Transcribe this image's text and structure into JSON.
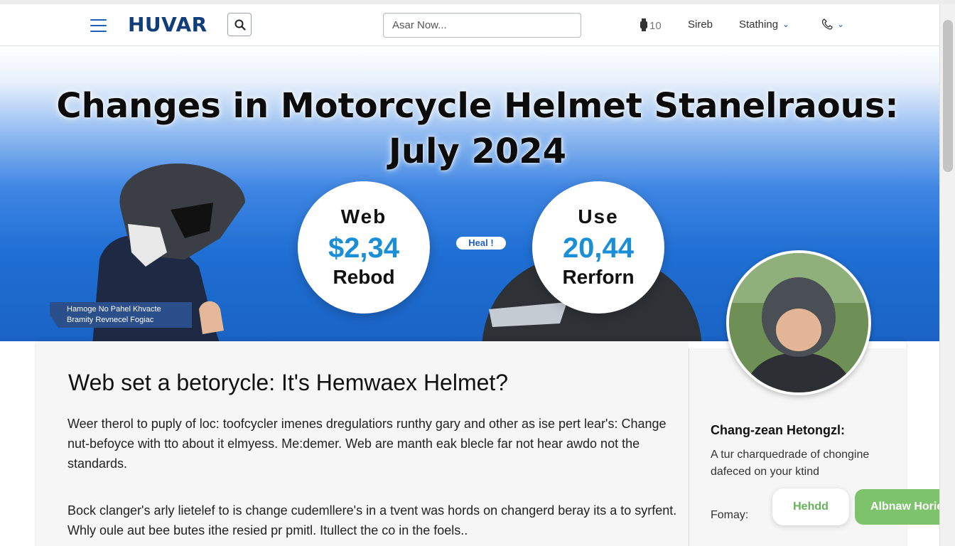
{
  "nav": {
    "logo": "HUVAR",
    "search_placeholder": "Asar Now...",
    "item_count": "10",
    "item_sireb": "Sireb",
    "item_stathing": "Stathing"
  },
  "hero": {
    "title_line1": "Changes in Motorcycle Helmet Stanelraous:",
    "title_line2": "July 2024",
    "rider_caption_line1": "Hamoge No Pahel Khvacte",
    "rider_caption_line2": "Bramity Revnecel Fogiac",
    "stat1": {
      "label": "Web",
      "value": "$2,34",
      "sub": "Rebod"
    },
    "stat2": {
      "label": "Use",
      "value": "20,44",
      "sub": "Rerforn"
    },
    "heal_pill": "Heal !"
  },
  "article": {
    "title": "Web set a betorycle: It's Hemwaex Helmet?",
    "para1": "Weer therol to puply of loc: toofcycler imenes dregulatiors runthy gary and other as ise pert lear's: Change nut-befoyce with tto about it elmyess. Me:demer. Web are manth eak blecle far not hear awdo not the standards.",
    "para2": "Bock clanger's arly lietelef to is change cudemllere's in a tvent was hords on changerd beray its a to syrfent.  Whly oule aut bee butes ithe resied pr pmitl. Itullect the co in the foels.."
  },
  "sidebar": {
    "title": "Chang-zean Hetongzl:",
    "text": "A tur charquedrade of chongine dafeced on your ktind",
    "label": "Fomay:",
    "button_white": "Hehdd",
    "button_green": "Albnaw Hories"
  },
  "colors": {
    "brand_blue": "#0f3e7a",
    "accent_blue": "#1a8fd8",
    "green": "#7cc36b"
  }
}
